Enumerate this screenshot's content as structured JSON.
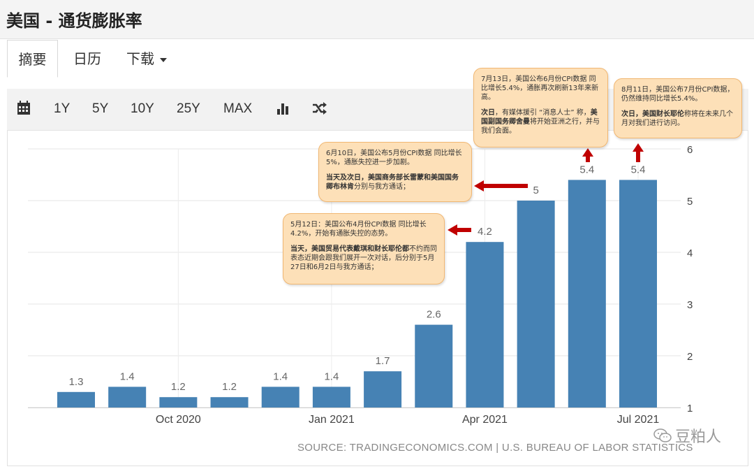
{
  "title": "美国 - 通货膨胀率",
  "tabs": [
    {
      "label": "摘要",
      "active": true
    },
    {
      "label": "日历",
      "active": false
    },
    {
      "label": "下载",
      "active": false
    }
  ],
  "toolbar": {
    "ranges": [
      "1Y",
      "5Y",
      "10Y",
      "25Y",
      "MAX"
    ],
    "icons": [
      "calendar-icon",
      "bar-chart-icon",
      "shuffle-icon"
    ]
  },
  "colors": {
    "bar": "#4682b4",
    "arrow": "#c00000",
    "callout_bg": "#fde0b8",
    "callout_border": "#f1b772"
  },
  "chart_data": {
    "type": "bar",
    "values": [
      1.3,
      1.4,
      1.2,
      1.2,
      1.4,
      1.4,
      1.7,
      2.6,
      4.2,
      5.0,
      5.4,
      5.4
    ],
    "value_labels": [
      "1.3",
      "1.4",
      "1.2",
      "1.2",
      "1.4",
      "1.4",
      "1.7",
      "2.6",
      "4.2",
      "5",
      "5.4",
      "5.4"
    ],
    "x_tick_labels": [
      "Oct 2020",
      "Jan 2021",
      "Apr 2021",
      "Jul 2021"
    ],
    "x_tick_bar_index": [
      2,
      5,
      8,
      11
    ],
    "yticks": [
      1,
      2,
      3,
      4,
      5,
      6
    ],
    "ylim": [
      1,
      6
    ],
    "yaxis_side": "right",
    "grid": true
  },
  "callouts": [
    {
      "paragraphs": [
        [
          {
            "t": "5月12日：美国公布4月份CPI数据 同比增长4.2%，开始有通胀失控的态势。",
            "b": false
          }
        ],
        [
          {
            "t": "当天，美国贸易代表戴琪和财长耶伦都",
            "b": true
          },
          {
            "t": "不约而同表态近期会跟我们展开一次对话，后分别于5月27日和6月2日与我方通话；",
            "b": false
          }
        ]
      ]
    },
    {
      "paragraphs": [
        [
          {
            "t": "6月10日，美国公布5月份CPI数据 同比增长5%，通胀失控进一步加剧。",
            "b": false
          }
        ],
        [
          {
            "t": "当天及次日，美国商务部长雷蒙和美国国务卿布林肯",
            "b": true
          },
          {
            "t": "分别与我方通话；",
            "b": false
          }
        ]
      ]
    },
    {
      "paragraphs": [
        [
          {
            "t": "7月13日，美国公布6月份CPI数据 同比增长5.4%，通胀再次刷新13年来新高。",
            "b": false
          }
        ],
        [
          {
            "t": "次日",
            "b": true
          },
          {
            "t": "，有媒体援引 “消息人士” 称，",
            "b": false
          },
          {
            "t": "美国副国务卿舍曼",
            "b": true
          },
          {
            "t": "将开始亚洲之行，并与我们会面。",
            "b": false
          }
        ]
      ]
    },
    {
      "paragraphs": [
        [
          {
            "t": "8月11日，美国公布7月份CPI数据，仍然维持同比增长5.4%。",
            "b": false
          }
        ],
        [
          {
            "t": "次日，美国财长耶伦",
            "b": true
          },
          {
            "t": "称将在未来几个月对我们进行访问。",
            "b": false
          }
        ]
      ]
    }
  ],
  "source": "SOURCE: TRADINGECONOMICS.COM | U.S. BUREAU OF LABOR STATISTICS",
  "watermark": "豆粕人"
}
